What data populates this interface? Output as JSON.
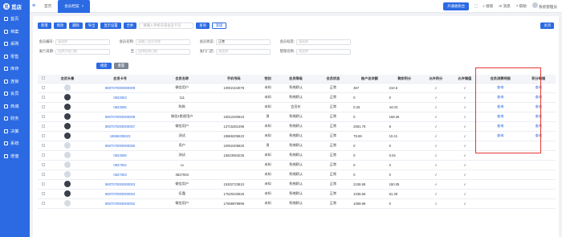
{
  "app": {
    "name": "觅店"
  },
  "sidebar": {
    "items": [
      {
        "label": "首页",
        "icon": "home-icon"
      },
      {
        "label": "档案",
        "icon": "folder-icon"
      },
      {
        "label": "采购",
        "icon": "cart-icon"
      },
      {
        "label": "零售",
        "icon": "shop-icon"
      },
      {
        "label": "库存",
        "icon": "box-icon"
      },
      {
        "label": "连锁",
        "icon": "chain-icon"
      },
      {
        "label": "会员",
        "icon": "user-icon"
      },
      {
        "label": "商城",
        "icon": "mall-icon"
      },
      {
        "label": "财务",
        "icon": "money-icon"
      },
      {
        "label": "决策",
        "icon": "chart-icon"
      },
      {
        "label": "系统",
        "icon": "gear-icon"
      },
      {
        "label": "增值",
        "icon": "plus-icon"
      }
    ]
  },
  "topbar": {
    "tabs": [
      {
        "label": "首页"
      },
      {
        "label": "会员档案"
      }
    ],
    "open_cashier": "开通收款台",
    "search": "搜索",
    "messages": "消息",
    "help": "帮助",
    "user": "系统管理员"
  },
  "toolbar": {
    "buttons": [
      "新增",
      "修改",
      "删除",
      "导出",
      "显示设置",
      "合并",
      "查询",
      "高级"
    ],
    "search_placeholder": "请输入手机号或会员卡号",
    "extra": "关闭"
  },
  "filters": {
    "row1": [
      {
        "label": "会员编号:",
        "placeholder": "请选择",
        "value": ""
      },
      {
        "label": "会员名称:",
        "placeholder": "请输入会员名称",
        "value": ""
      },
      {
        "label": "会员状态:",
        "placeholder": "",
        "value": "正常"
      },
      {
        "label": "会员标签:",
        "placeholder": "请选择",
        "value": ""
      }
    ],
    "row2": [
      {
        "label": "发行日期:",
        "placeholder": "选择开始日期",
        "value": ""
      },
      {
        "label": "至",
        "placeholder": "选择结束日期",
        "value": ""
      },
      {
        "label": "发行门店:",
        "placeholder": "请选择",
        "value": ""
      },
      {
        "label": "管理名称:",
        "placeholder": "请选择",
        "value": ""
      }
    ],
    "search_button": "搜索",
    "reset_button": "重置"
  },
  "table": {
    "headers": [
      "",
      "会员头像",
      "会员卡号",
      "会员名称",
      "手机号码",
      "性别",
      "会员等级",
      "会员状态",
      "账户总余额",
      "剩余积分",
      "允许积分",
      "允许储值",
      "会员消费明细",
      "积分明细"
    ],
    "rows": [
      {
        "avatar": "blank",
        "card": "9807070000000009",
        "name": "微信用户",
        "phone": "10002104078",
        "sex": "未知",
        "level": "系统默认",
        "status": "正常",
        "balance": "367",
        "points": "210.6",
        "allow_pts": "√",
        "allow_store": "√",
        "detail": "查询",
        "pts_detail": "查询"
      },
      {
        "avatar": "photo",
        "card": "0823003",
        "name": "111",
        "phone": "",
        "sex": "未知",
        "level": "系统默认",
        "status": "正常",
        "balance": "0",
        "points": "0",
        "allow_pts": "√",
        "allow_store": "√",
        "detail": "查询",
        "pts_detail": "查询"
      },
      {
        "avatar": "photo",
        "card": "0823006",
        "name": "陈陈",
        "phone": "",
        "sex": "未知",
        "level": "会员价",
        "status": "正常",
        "balance": "0.26",
        "points": "44.03",
        "allow_pts": "√",
        "allow_store": "√",
        "detail": "查询",
        "pts_detail": "查询"
      },
      {
        "avatar": "photo",
        "card": "9807070000000008",
        "name": "微信1影视用户",
        "phone": "15012340623",
        "sex": "男",
        "level": "系统默认",
        "status": "正常",
        "balance": "0",
        "points": "158.26",
        "allow_pts": "√",
        "allow_store": "√",
        "detail": "查询",
        "pts_detail": "查询"
      },
      {
        "avatar": "photo",
        "card": "9807070000000007",
        "name": "微信用户",
        "phone": "13715281496",
        "sex": "未知",
        "level": "系统默认",
        "status": "正常",
        "balance": "2591.79",
        "points": "8",
        "allow_pts": "√",
        "allow_store": "√",
        "detail": "查询",
        "pts_detail": "查询"
      },
      {
        "avatar": "photo",
        "card": "18666206623",
        "name": "测试",
        "phone": "18666206623",
        "sex": "未知",
        "level": "系统默认",
        "status": "正常",
        "balance": "78.69",
        "points": "10.41",
        "allow_pts": "√",
        "allow_store": "√",
        "detail": "查询",
        "pts_detail": "查询"
      },
      {
        "avatar": "blank",
        "card": "9807070000000005",
        "name": "用户",
        "phone": "10002405820",
        "sex": "男",
        "level": "系统默认",
        "status": "正常",
        "balance": "0",
        "points": "0",
        "allow_pts": "√",
        "allow_store": "√",
        "detail": "",
        "pts_detail": ""
      },
      {
        "avatar": "blank",
        "card": "0823008",
        "name": "测试",
        "phone": "15623084235",
        "sex": "未知",
        "level": "系统默认",
        "status": "正常",
        "balance": "0",
        "points": "0.04",
        "allow_pts": "√",
        "allow_store": "√",
        "detail": "",
        "pts_detail": ""
      },
      {
        "avatar": "blank",
        "card": "0827004",
        "name": "cx",
        "phone": "",
        "sex": "未知",
        "level": "系统默认",
        "status": "正常",
        "balance": "0",
        "points": "0",
        "allow_pts": "√",
        "allow_store": "√",
        "detail": "",
        "pts_detail": ""
      },
      {
        "avatar": "blank",
        "card": "0827003",
        "name": "0827003",
        "phone": "",
        "sex": "未知",
        "level": "系统默认",
        "status": "正常",
        "balance": "0",
        "points": "0",
        "allow_pts": "√",
        "allow_store": "√",
        "detail": "",
        "pts_detail": ""
      },
      {
        "avatar": "photo",
        "card": "9807070000000003",
        "name": "微信用户",
        "phone": "15302723810",
        "sex": "未知",
        "level": "系统默认",
        "status": "正常",
        "balance": "2106.95",
        "points": "150.05",
        "allow_pts": "√",
        "allow_store": "√",
        "detail": "",
        "pts_detail": ""
      },
      {
        "avatar": "photo",
        "card": "9807070000000004",
        "name": "伍霞",
        "phone": "17520240626",
        "sex": "未知",
        "level": "系统默认",
        "status": "正常",
        "balance": "1036.65",
        "points": "61.39",
        "allow_pts": "√",
        "allow_store": "√",
        "detail": "",
        "pts_detail": ""
      },
      {
        "avatar": "blank",
        "card": "9807070000000002",
        "name": "微信用户",
        "phone": "17698979996",
        "sex": "未知",
        "level": "系统默认",
        "status": "正常",
        "balance": "1059.96",
        "points": "0",
        "allow_pts": "√",
        "allow_store": "√",
        "detail": "",
        "pts_detail": ""
      }
    ]
  }
}
